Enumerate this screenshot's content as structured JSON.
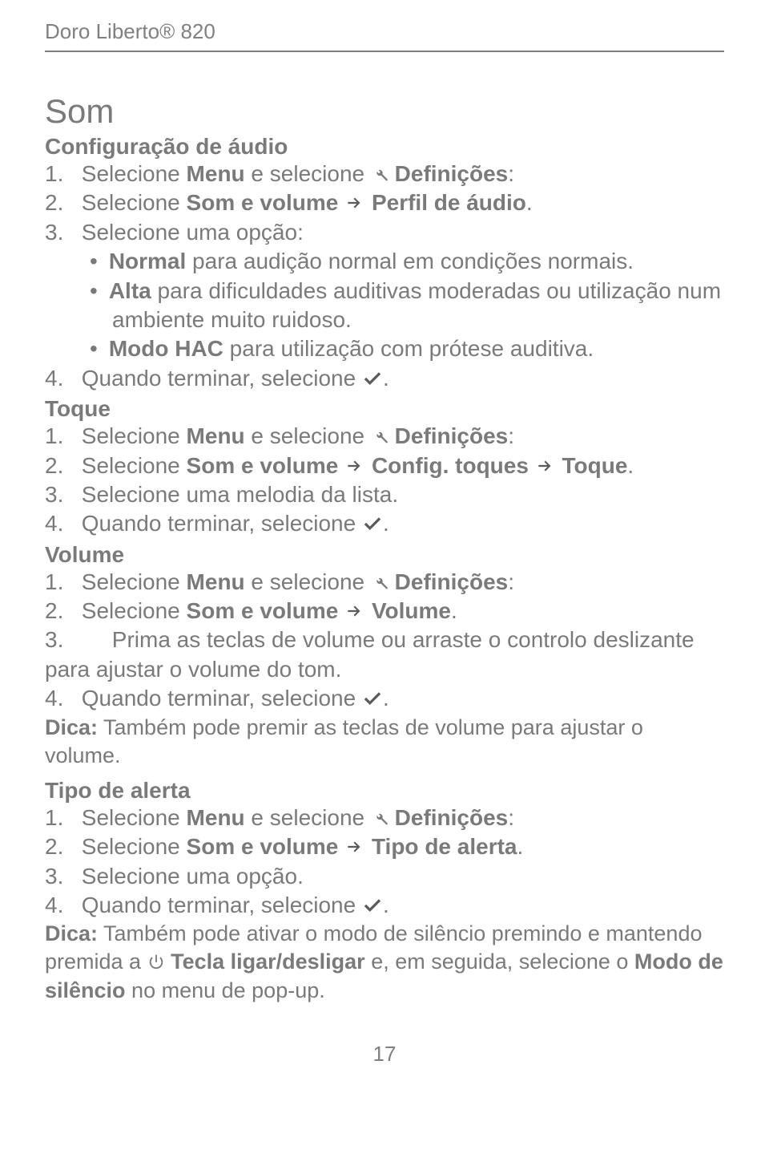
{
  "header": "Doro Liberto® 820",
  "h1": "Som",
  "sec1": {
    "title": "Configuração de áudio",
    "s1a": "1.",
    "s1b": "  Selecione ",
    "s1c": "Menu",
    "s1d": " e selecione ",
    "s1e": " Definições",
    "s1f": ":",
    "s2a": "2.",
    "s2b": "  Selecione ",
    "s2c": "Som e volume",
    "s2d": " Perfil de áudio",
    "s2e": ".",
    "s3a": "3.",
    "s3b": "  Selecione uma opção:",
    "b1a": "Normal",
    "b1b": " para audição normal em condições normais.",
    "b2a": "Alta",
    "b2b": " para dificuldades auditivas moderadas ou utilização num ambiente muito ruidoso.",
    "b3a": "Modo HAC",
    "b3b": " para utilização com prótese auditiva.",
    "s4a": "4.",
    "s4b": "  Quando terminar, selecione ",
    "s4c": "."
  },
  "sec2": {
    "title": "Toque",
    "s1a": "1.",
    "s1b": "  Selecione ",
    "s1c": "Menu",
    "s1d": " e selecione ",
    "s1e": " Definições",
    "s1f": ":",
    "s2a": "2.",
    "s2b": "  Selecione ",
    "s2c": "Som e volume",
    "s2d": " Config. toques",
    "s2e": " Toque",
    "s2f": ".",
    "s3a": "3.",
    "s3b": "  Selecione uma melodia da lista.",
    "s4a": "4.",
    "s4b": "  Quando terminar, selecione ",
    "s4c": "."
  },
  "sec3": {
    "title": "Volume",
    "s1a": "1.",
    "s1b": "  Selecione ",
    "s1c": "Menu",
    "s1d": " e selecione ",
    "s1e": " Definições",
    "s1f": ":",
    "s2a": "2.",
    "s2b": "  Selecione ",
    "s2c": "Som e volume",
    "s2d": " Volume",
    "s2e": ".",
    "s3a": "3.",
    "s3b": "  Prima as teclas de volume ou arraste o controlo deslizante para ajustar o volume do tom.",
    "s4a": "4.",
    "s4b": "  Quando terminar, selecione ",
    "s4c": ".",
    "tipLabel": "Dica:",
    "tipText": " Também pode premir as teclas de volume para ajustar o volume."
  },
  "sec4": {
    "title": "Tipo de alerta",
    "s1a": "1.",
    "s1b": "  Selecione ",
    "s1c": "Menu",
    "s1d": " e selecione ",
    "s1e": " Definições",
    "s1f": ":",
    "s2a": "2.",
    "s2b": "  Selecione ",
    "s2c": "Som e volume",
    "s2d": " Tipo de alerta",
    "s2e": ".",
    "s3a": "3.",
    "s3b": "  Selecione uma opção.",
    "s4a": "4.",
    "s4b": "  Quando terminar, selecione ",
    "s4c": ".",
    "tipLabel": "Dica:",
    "tipText1": " Também pode ativar o modo de silêncio premindo e mantendo premida a ",
    "tipBold1": " Tecla ligar/desligar",
    "tipText2": " e, em seguida, selecione o ",
    "tipBold2": "Modo de silêncio",
    "tipText3": " no menu de pop-up."
  },
  "pagenum": "17"
}
